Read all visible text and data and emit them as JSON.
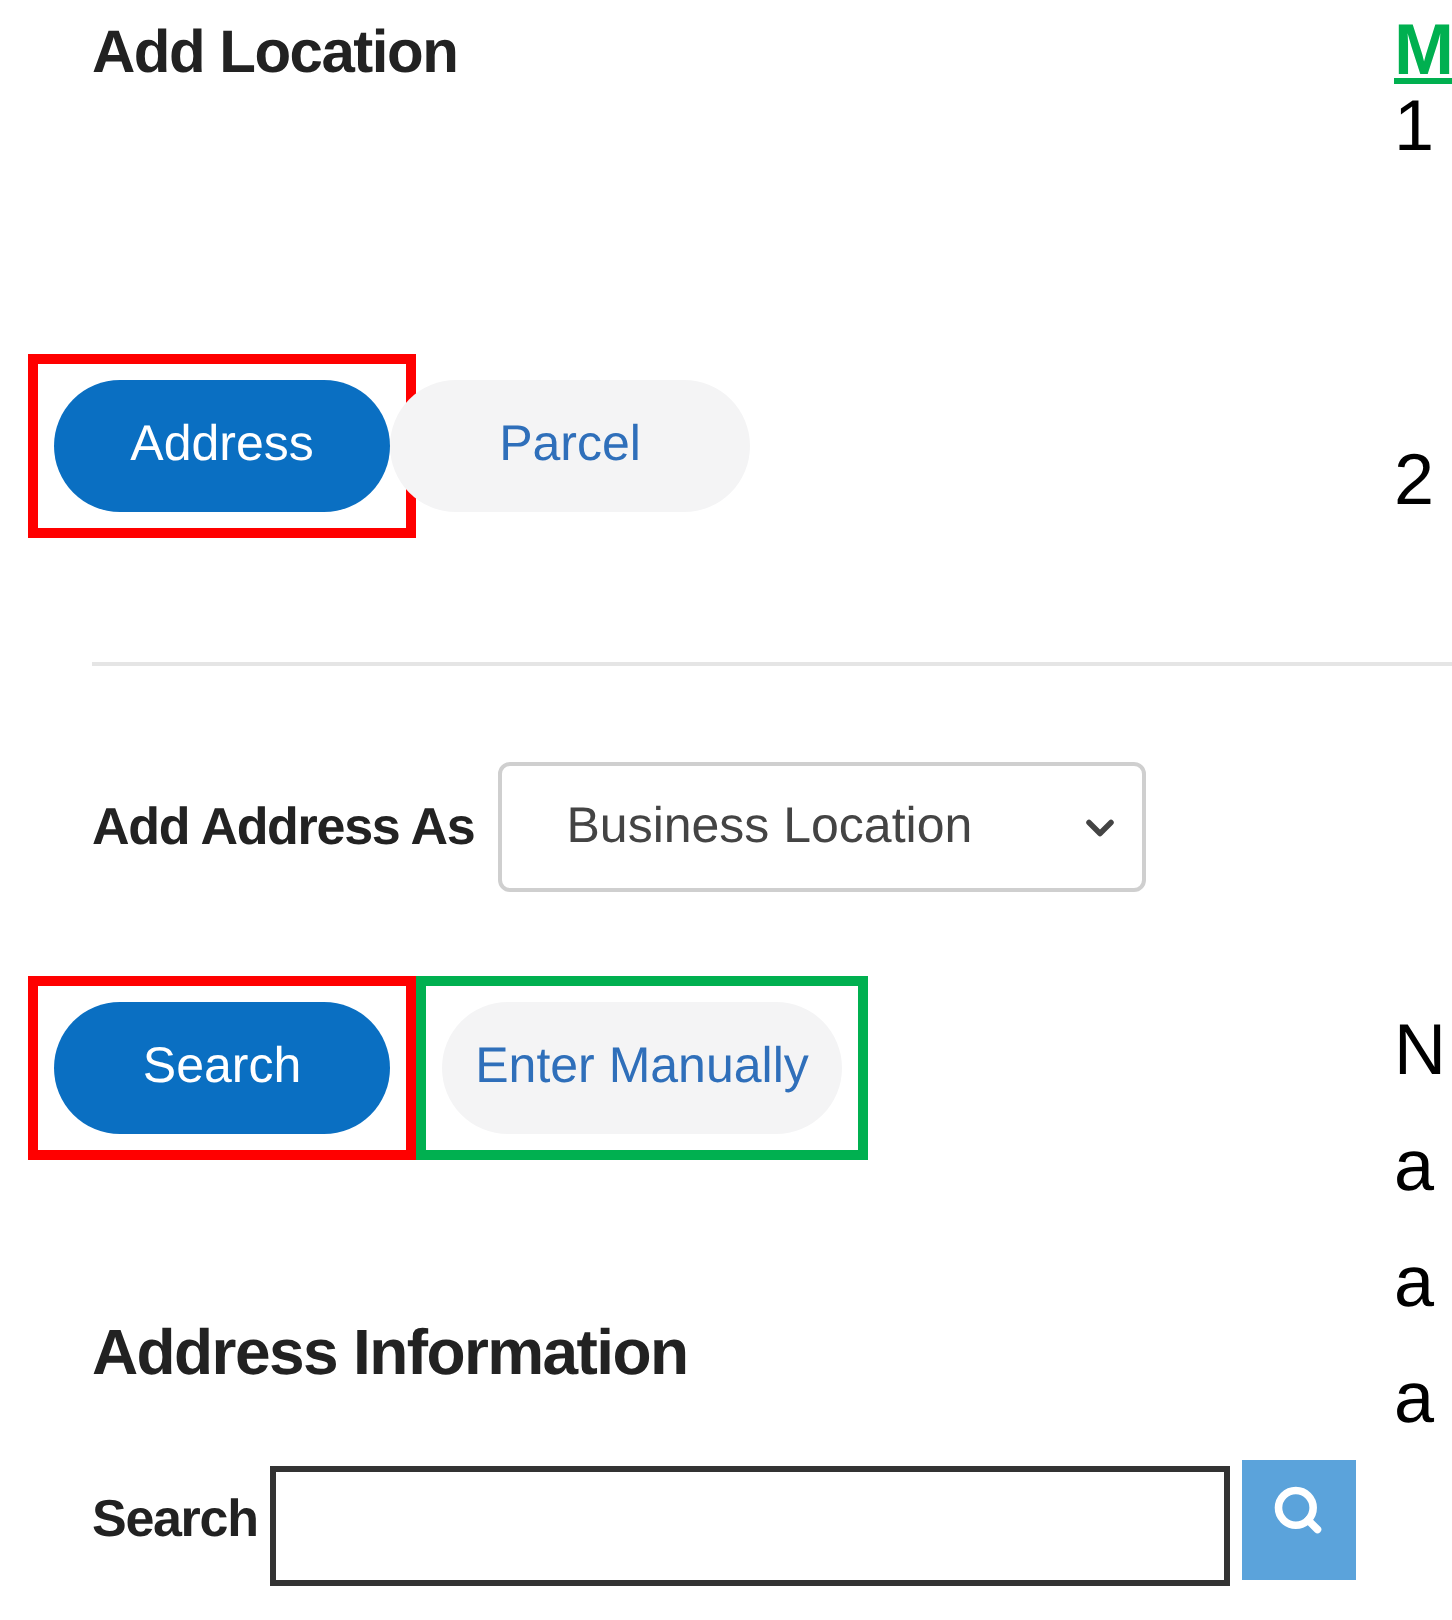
{
  "panel": {
    "title": "Add Location",
    "location_type_toggle": [
      {
        "label": "Address",
        "selected": true,
        "color": "#ff0000"
      },
      {
        "label": "Parcel",
        "selected": false
      }
    ],
    "add_address_as": {
      "label": "Add Address As",
      "value": "Business Location"
    },
    "actions": [
      {
        "label": "Search",
        "selected": true,
        "color": "#ff0000"
      },
      {
        "label": "Enter Manually",
        "selected": false,
        "color": "#00b050"
      }
    ],
    "section_title": "Address Information",
    "search": {
      "label": "Search"
    }
  },
  "side_text": [
    {
      "text": "M",
      "kind": "heading"
    },
    {
      "text": "1",
      "kind": "line"
    },
    {
      "text": "2",
      "kind": "line"
    },
    {
      "text": "N",
      "kind": "line"
    },
    {
      "text": "a",
      "kind": "line"
    },
    {
      "text": "a",
      "kind": "line"
    },
    {
      "text": "a",
      "kind": "line"
    }
  ]
}
